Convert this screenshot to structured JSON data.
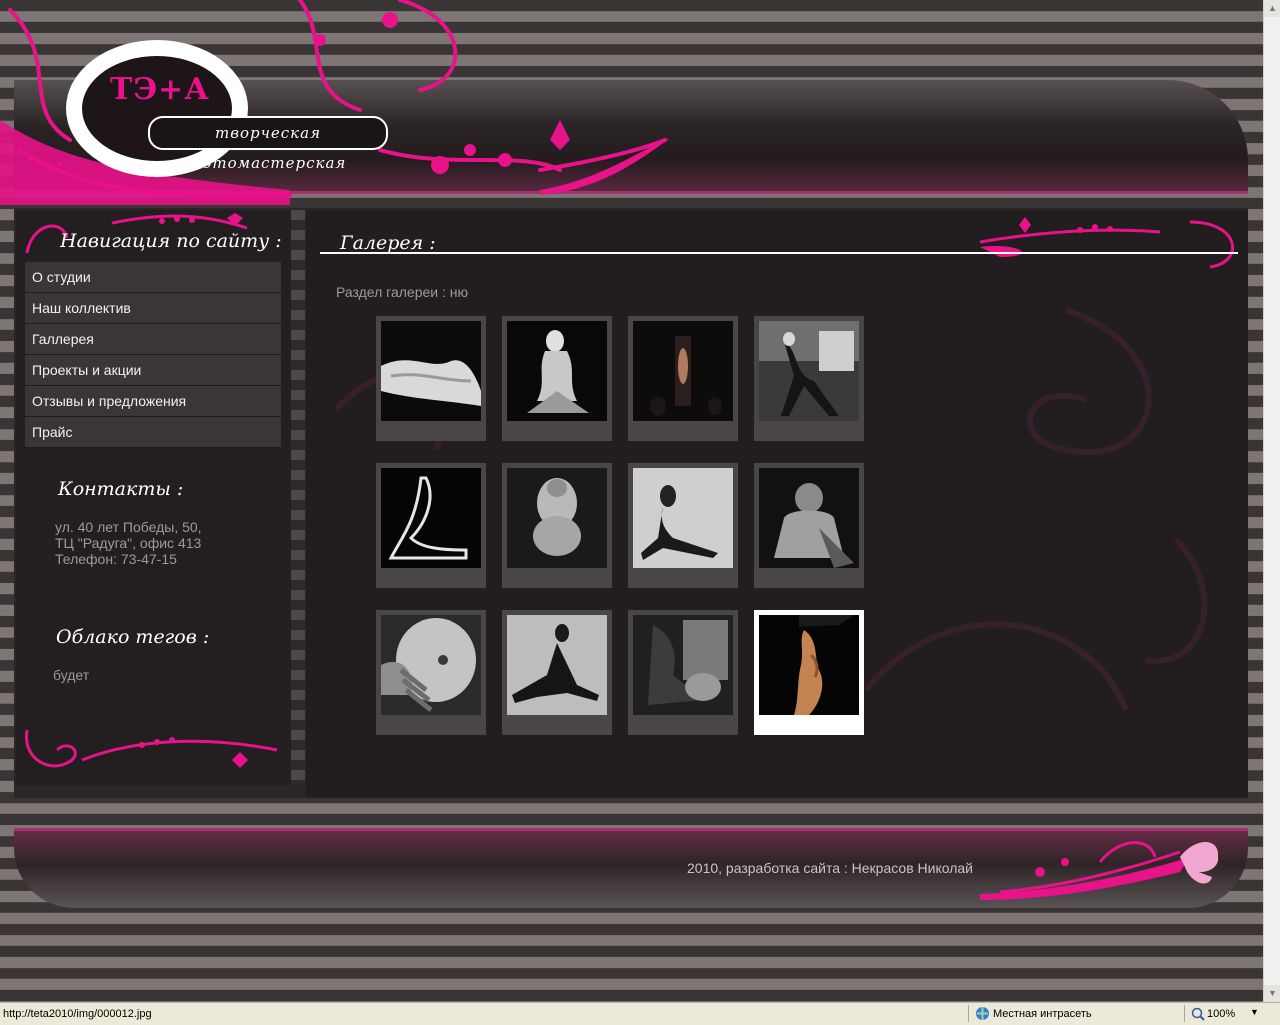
{
  "header": {
    "logo_text": "ТЭ+А",
    "tagline": "творческая фотомастерская"
  },
  "sidebar": {
    "nav_title": "Навигация по сайту :",
    "nav_items": [
      {
        "label": "О студии"
      },
      {
        "label": "Наш коллектив"
      },
      {
        "label": "Галлерея"
      },
      {
        "label": "Проекты и акции"
      },
      {
        "label": "Отзывы и предложения"
      },
      {
        "label": "Прайс"
      }
    ],
    "contacts_title": "Контакты :",
    "contacts_lines": [
      "ул. 40 лет Победы, 50,",
      "ТЦ \"Радуга\", офис 413",
      "Телефон: 73-47-15"
    ],
    "tags_title": "Облако тегов :",
    "tags_text": "будет"
  },
  "gallery": {
    "title": "Галерея :",
    "section_label": "Раздел галереи : ню",
    "thumbnails": [
      {
        "id": 1,
        "active": false
      },
      {
        "id": 2,
        "active": false
      },
      {
        "id": 3,
        "active": false
      },
      {
        "id": 4,
        "active": false
      },
      {
        "id": 5,
        "active": false
      },
      {
        "id": 6,
        "active": false
      },
      {
        "id": 7,
        "active": false
      },
      {
        "id": 8,
        "active": false
      },
      {
        "id": 9,
        "active": false
      },
      {
        "id": 10,
        "active": false
      },
      {
        "id": 11,
        "active": false
      },
      {
        "id": 12,
        "active": true
      }
    ]
  },
  "footer": {
    "credit": "2010, разработка сайта : Некрасов Николай"
  },
  "statusbar": {
    "url": "http://teta2010/img/000012.jpg",
    "zone": "Местная интрасеть",
    "zoom": "100%"
  },
  "colors": {
    "accent_pink": "#e8128a",
    "nav_bg": "#3a3636",
    "page_bg": "#221d1e"
  }
}
